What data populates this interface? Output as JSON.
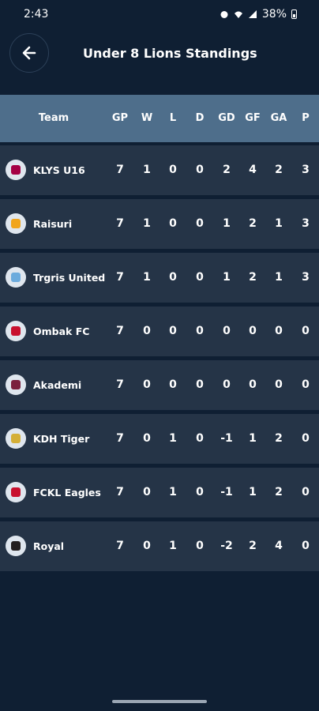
{
  "status_bar": {
    "time": "2:43",
    "battery": "38%"
  },
  "header": {
    "title": "Under 8 Lions Standings"
  },
  "columns": {
    "team": "Team",
    "gp": "GP",
    "w": "W",
    "l": "L",
    "d": "D",
    "gd": "GD",
    "gf": "GF",
    "ga": "GA",
    "p": "P"
  },
  "rows": [
    {
      "team": "KLYS U16",
      "logo_color": "#a50044",
      "gp": "7",
      "w": "1",
      "l": "0",
      "d": "0",
      "gd": "2",
      "gf": "4",
      "ga": "2",
      "p": "3"
    },
    {
      "team": "Raisuri",
      "logo_color": "#f1a51c",
      "gp": "7",
      "w": "1",
      "l": "0",
      "d": "0",
      "gd": "1",
      "gf": "2",
      "ga": "1",
      "p": "3"
    },
    {
      "team": "Trgris United",
      "logo_color": "#6cabdd",
      "gp": "7",
      "w": "1",
      "l": "0",
      "d": "0",
      "gd": "1",
      "gf": "2",
      "ga": "1",
      "p": "3"
    },
    {
      "team": "Ombak FC",
      "logo_color": "#c8102e",
      "gp": "7",
      "w": "0",
      "l": "0",
      "d": "0",
      "gd": "0",
      "gf": "0",
      "ga": "0",
      "p": "0"
    },
    {
      "team": "Akademi",
      "logo_color": "#7a1f3d",
      "gp": "7",
      "w": "0",
      "l": "0",
      "d": "0",
      "gd": "0",
      "gf": "0",
      "ga": "0",
      "p": "0"
    },
    {
      "team": "KDH Tiger",
      "logo_color": "#d4af37",
      "gp": "7",
      "w": "0",
      "l": "1",
      "d": "0",
      "gd": "-1",
      "gf": "1",
      "ga": "2",
      "p": "0"
    },
    {
      "team": "FCKL Eagles",
      "logo_color": "#c8102e",
      "gp": "7",
      "w": "0",
      "l": "1",
      "d": "0",
      "gd": "-1",
      "gf": "1",
      "ga": "2",
      "p": "0"
    },
    {
      "team": "Royal",
      "logo_color": "#241f20",
      "gp": "7",
      "w": "0",
      "l": "1",
      "d": "0",
      "gd": "-2",
      "gf": "2",
      "ga": "4",
      "p": "0"
    }
  ]
}
